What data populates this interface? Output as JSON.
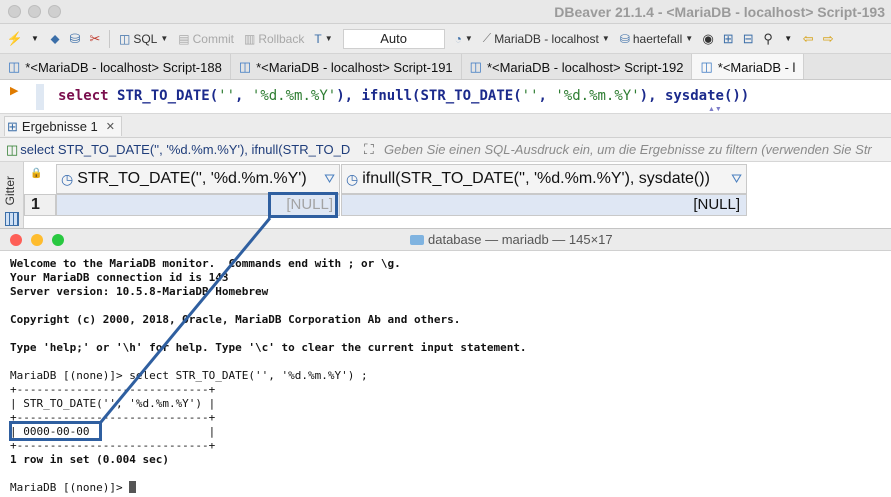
{
  "dbeaver": {
    "window_title": "DBeaver 21.1.4 - <MariaDB - localhost> Script-193",
    "toolbar": {
      "sql_label": "SQL",
      "commit_label": "Commit",
      "rollback_label": "Rollback",
      "transaction_mode": "Auto",
      "connection_label": "MariaDB - localhost",
      "database_label": "haertefall"
    },
    "tabs": [
      {
        "label": "*<MariaDB - localhost> Script-188"
      },
      {
        "label": "*<MariaDB - localhost> Script-191"
      },
      {
        "label": "*<MariaDB - localhost> Script-192"
      },
      {
        "label": "*<MariaDB - l"
      }
    ],
    "editor": {
      "sql_keyword": "select",
      "fn1": "STR_TO_DATE(",
      "str1": "''",
      "sep1": ", ",
      "str2": "'%d.%m.%Y'",
      "close1": "), ",
      "fn2": "ifnull(STR_TO_DATE(",
      "str3": "''",
      "sep2": ", ",
      "str4": "'%d.%m.%Y'",
      "close2": "), ",
      "fn3": "sysdate())"
    },
    "results": {
      "tab_label": "Ergebnisse 1",
      "filter_query": "select STR_TO_DATE('', '%d.%m.%Y'), ifnull(STR_TO_D",
      "filter_placeholder": "Geben Sie einen SQL-Ausdruck ein, um die Ergebnisse zu filtern (verwenden Sie Str",
      "side_label": "Gitter",
      "columns": [
        "STR_TO_DATE('', '%d.%m.%Y')",
        "ifnull(STR_TO_DATE('', '%d.%m.%Y'), sysdate())"
      ],
      "rows": [
        {
          "num": "1",
          "cells": [
            "[NULL]",
            "[NULL]"
          ]
        }
      ]
    }
  },
  "terminal": {
    "window_title": "database — mariadb — 145×17",
    "lines": [
      {
        "text": "Welcome to the MariaDB monitor.  Commands end with ; or \\g.",
        "bold": true
      },
      {
        "text": "Your MariaDB connection id is 143",
        "bold": true
      },
      {
        "text": "Server version: 10.5.8-MariaDB Homebrew",
        "bold": true
      },
      {
        "text": "",
        "bold": false
      },
      {
        "text": "Copyright (c) 2000, 2018, Oracle, MariaDB Corporation Ab and others.",
        "bold": true
      },
      {
        "text": "",
        "bold": false
      },
      {
        "text": "Type 'help;' or '\\h' for help. Type '\\c' to clear the current input statement.",
        "bold": true
      },
      {
        "text": "",
        "bold": false
      },
      {
        "text": "MariaDB [(none)]> select STR_TO_DATE('', '%d.%m.%Y') ;",
        "bold": false
      },
      {
        "text": "+-----------------------------+",
        "bold": false
      },
      {
        "text": "| STR_TO_DATE('', '%d.%m.%Y') |",
        "bold": false
      },
      {
        "text": "+-----------------------------+",
        "bold": false
      },
      {
        "text": "| 0000-00-00                  |",
        "bold": false
      },
      {
        "text": "+-----------------------------+",
        "bold": false
      },
      {
        "text": "1 row in set (0.004 sec)",
        "bold": true
      },
      {
        "text": "",
        "bold": false
      },
      {
        "text": "MariaDB [(none)]> ",
        "bold": false
      }
    ]
  },
  "colors": {
    "callout": "#2f5fa0",
    "selected_row": "#dfe7f4",
    "keyword": "#7a0e4d",
    "string": "#2e7d32",
    "traffic_red": "#fe5f57",
    "traffic_yellow": "#febc2e",
    "traffic_green": "#28c840"
  },
  "icons": [
    "plug-icon",
    "database-icon",
    "disconnect-icon",
    "sql-editor-icon",
    "commit-icon",
    "rollback-icon",
    "transaction-icon",
    "history-icon",
    "connection-icon",
    "schema-icon",
    "search-icon",
    "export-icon"
  ]
}
